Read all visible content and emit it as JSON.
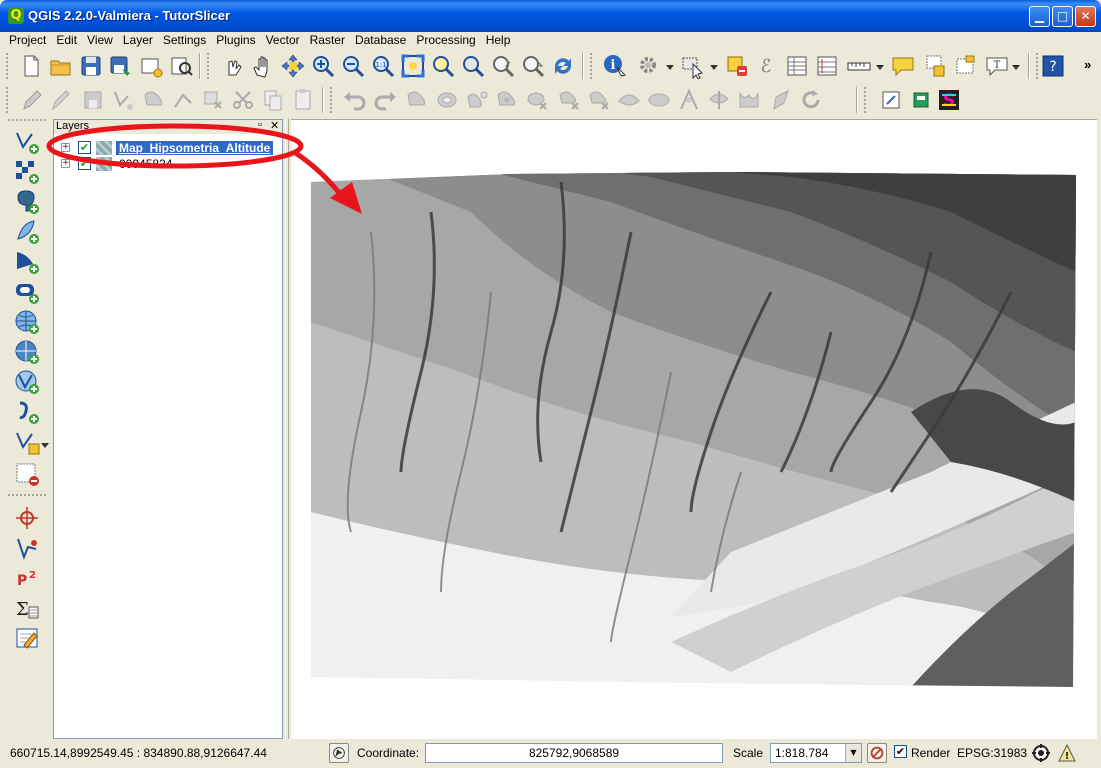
{
  "window": {
    "title": "QGIS 2.2.0-Valmiera - TutorSlicer",
    "app_icon_glyph": "Q"
  },
  "menubar": {
    "items": [
      "Project",
      "Edit",
      "View",
      "Layer",
      "Settings",
      "Plugins",
      "Vector",
      "Raster",
      "Database",
      "Processing",
      "Help"
    ]
  },
  "toolbar": {
    "overflow_glyph": "»"
  },
  "layers_panel": {
    "header": "Layers",
    "layers": [
      {
        "name": "Map_Hipsometria_Altitude",
        "checked": true,
        "selected": true
      },
      {
        "name": "00945824",
        "checked": true,
        "selected": false
      }
    ]
  },
  "statusbar": {
    "extent": "660715.14,8992549.45 : 834890.88,9126647.44",
    "coordinate_label": "Coordinate:",
    "coordinate_value": "825792,9068589",
    "scale_label": "Scale",
    "scale_value": "1:818.784",
    "render_label": "Render",
    "render_checked": true,
    "crs": "EPSG:31983"
  },
  "colors": {
    "titlebar": "#0058e6",
    "selection": "#316ac5",
    "annotation": "#e8151b",
    "chrome": "#ece9d8"
  }
}
